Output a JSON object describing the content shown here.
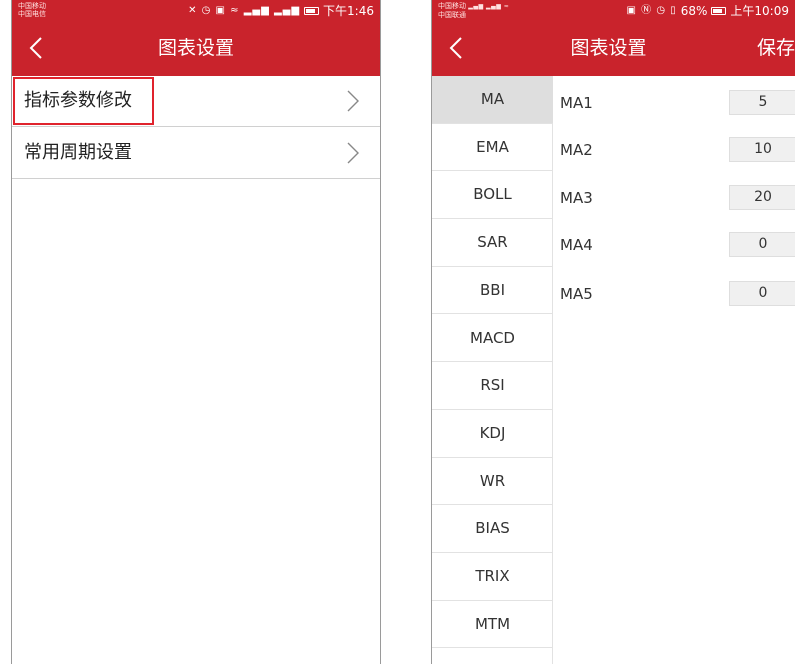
{
  "left_screen": {
    "status": {
      "carrier_1": "中国移动",
      "carrier_2": "中国电信",
      "time": "下午1:46"
    },
    "nav": {
      "title": "图表设置"
    },
    "menu": [
      {
        "label": "指标参数修改",
        "highlighted": true
      },
      {
        "label": "常用周期设置",
        "highlighted": false
      }
    ]
  },
  "right_screen": {
    "status": {
      "carrier_1": "中国移动",
      "carrier_2": "中国联通",
      "battery": "68%",
      "time": "上午10:09"
    },
    "nav": {
      "title": "图表设置",
      "save_label": "保存"
    },
    "indicators": [
      "MA",
      "EMA",
      "BOLL",
      "SAR",
      "BBI",
      "MACD",
      "RSI",
      "KDJ",
      "WR",
      "BIAS",
      "TRIX",
      "MTM"
    ],
    "selected_indicator": "MA",
    "params": [
      {
        "label": "MA1",
        "value": "5"
      },
      {
        "label": "MA2",
        "value": "10"
      },
      {
        "label": "MA3",
        "value": "20"
      },
      {
        "label": "MA4",
        "value": "0"
      },
      {
        "label": "MA5",
        "value": "0"
      }
    ]
  },
  "colors": {
    "brand_red": "#c9232c",
    "highlight_red": "#e0232d",
    "active_bg": "#dedede"
  }
}
